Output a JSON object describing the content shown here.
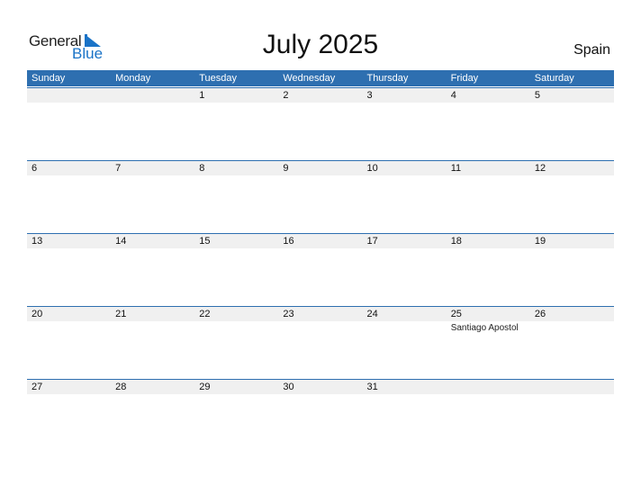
{
  "logo": {
    "general": "General",
    "blue": "Blue"
  },
  "title": "July 2025",
  "country": "Spain",
  "colors": {
    "header_bg": "#2e6fb0",
    "accent": "#1a73c7",
    "band": "#f0f0f0"
  },
  "weekdays": [
    "Sunday",
    "Monday",
    "Tuesday",
    "Wednesday",
    "Thursday",
    "Friday",
    "Saturday"
  ],
  "weeks": [
    {
      "days": [
        "",
        "",
        "1",
        "2",
        "3",
        "4",
        "5"
      ],
      "events": [
        "",
        "",
        "",
        "",
        "",
        "",
        ""
      ]
    },
    {
      "days": [
        "6",
        "7",
        "8",
        "9",
        "10",
        "11",
        "12"
      ],
      "events": [
        "",
        "",
        "",
        "",
        "",
        "",
        ""
      ]
    },
    {
      "days": [
        "13",
        "14",
        "15",
        "16",
        "17",
        "18",
        "19"
      ],
      "events": [
        "",
        "",
        "",
        "",
        "",
        "",
        ""
      ]
    },
    {
      "days": [
        "20",
        "21",
        "22",
        "23",
        "24",
        "25",
        "26"
      ],
      "events": [
        "",
        "",
        "",
        "",
        "",
        "Santiago Apostol",
        ""
      ]
    },
    {
      "days": [
        "27",
        "28",
        "29",
        "30",
        "31",
        "",
        ""
      ],
      "events": [
        "",
        "",
        "",
        "",
        "",
        "",
        ""
      ]
    }
  ]
}
